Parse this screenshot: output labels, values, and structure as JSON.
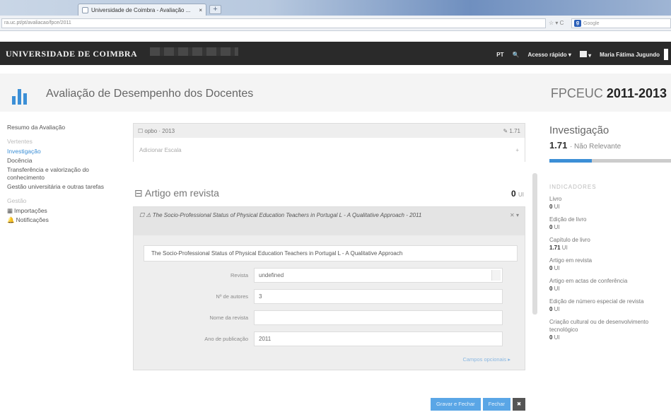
{
  "browser": {
    "tab_title": "Universidade de Coimbra - Avaliação ...",
    "tab_close": "×",
    "new_tab": "+",
    "url": "ra.uc.pt/pt/avaliacao/fpce/2011",
    "url_icons": "☆ ▾ C",
    "search_placeholder": "Google"
  },
  "topnav": {
    "university": "UNIVERSIDADE DE COIMBRA",
    "lang": "PT",
    "search_icon": "🔍",
    "quick_access": "Acesso rápido ▾",
    "apps": "▾",
    "user": "Maria Fátima Jugundo"
  },
  "header": {
    "title": "Avaliação de Desempenho dos Docentes",
    "unit": "FPCEUC",
    "period": "2011-2013"
  },
  "sidebar": {
    "summary": "Resumo da Avaliação",
    "group1": "Vertentes",
    "items": [
      "Investigação",
      "Docência",
      "Transferência e valorização do conhecimento",
      "Gestão universitária e outras tarefas"
    ],
    "group2": "Gestão",
    "imports": "Importações",
    "notifications": "Notificações"
  },
  "center": {
    "card1_header": "☐ opbo · 2013",
    "card1_score": "✎ 1.71",
    "card1_body": "Adicionar Escala",
    "card1_plus": "+",
    "section_title": "Artigo em revista",
    "section_count": "0",
    "section_unit": "UI",
    "article_title": "The Socio-Professional Status of Physical Education Teachers in Portugal L - A Qualitative Approach - 2011",
    "article_controls": "✕ ▾",
    "full_title": "The Socio-Professional Status of Physical Education Teachers in Portugal L - A Qualitative Approach",
    "fields": [
      {
        "label": "Revista",
        "value": "undefined"
      },
      {
        "label": "Nº de autores",
        "value": "3"
      },
      {
        "label": "Nome da revista",
        "value": ""
      },
      {
        "label": "Ano de publicação",
        "value": "2011"
      }
    ],
    "more_link": "Campos opcionais ▸",
    "btn_save": "Gravar e Fechar",
    "btn_close": "Fechar",
    "btn_delete": "✖"
  },
  "right": {
    "title": "Investigação",
    "score": "1.71",
    "score_label": "· Não Relevante",
    "progress_fraction": 0.35,
    "indicators_label": "INDICADORES",
    "indicators": [
      {
        "name": "Livro",
        "value": "0",
        "unit": "UI"
      },
      {
        "name": "Edição de livro",
        "value": "0",
        "unit": "UI"
      },
      {
        "name": "Capítulo de livro",
        "value": "1.71",
        "unit": "UI"
      },
      {
        "name": "Artigo em revista",
        "value": "0",
        "unit": "UI"
      },
      {
        "name": "Artigo em actas de conferência",
        "value": "0",
        "unit": "UI"
      },
      {
        "name": "Edição de número especial de revista",
        "value": "0",
        "unit": "UI"
      },
      {
        "name": "Criação cultural ou de desenvolvimento tecnológico",
        "value": "0",
        "unit": "UI"
      }
    ]
  }
}
